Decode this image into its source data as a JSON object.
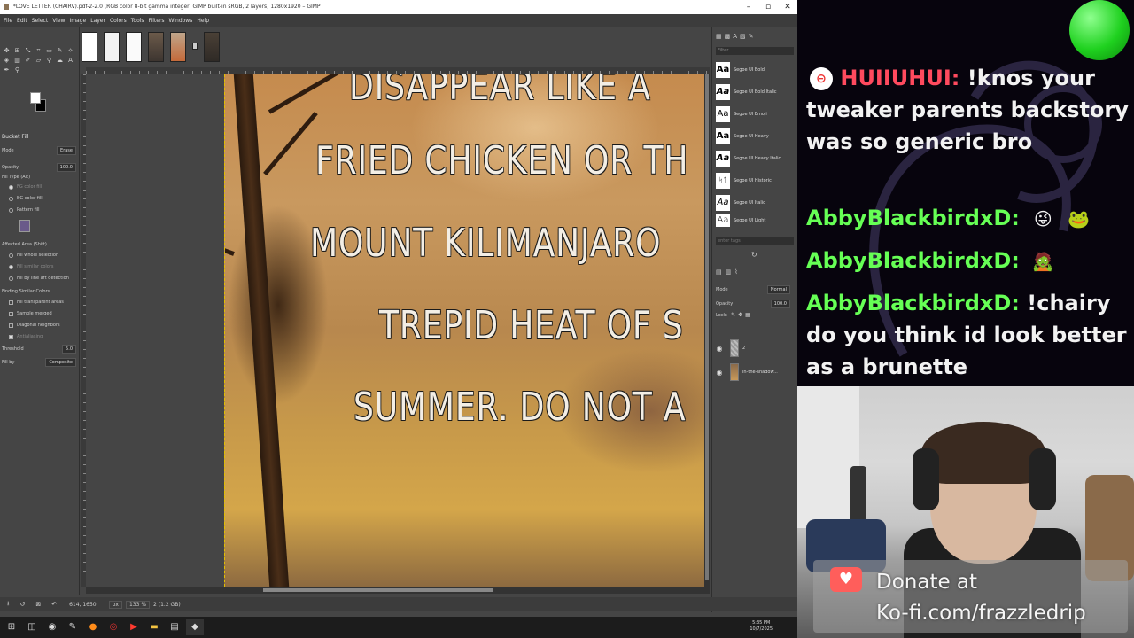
{
  "gimp": {
    "title": "*LOVE LETTER (CHAIRV).pdf-2-2.0 (RGB color 8-bit gamma integer, GIMP built-in sRGB, 2 layers) 1280x1920 – GIMP",
    "window_controls": [
      "–",
      "▫",
      "✕"
    ],
    "menu": [
      "File",
      "Edit",
      "Select",
      "View",
      "Image",
      "Layer",
      "Colors",
      "Tools",
      "Filters",
      "Windows",
      "Help"
    ],
    "tool_options": {
      "title": "Bucket Fill",
      "mode_label": "Mode",
      "mode_value": "Erase",
      "opacity_label": "Opacity",
      "opacity_value": "100.0",
      "fill_type_label": "Fill Type  (Alt)",
      "fill_types": [
        "FG color fill",
        "BG color fill",
        "Pattern fill"
      ],
      "affected_area_label": "Affected Area  (Shift)",
      "affected_areas": [
        "Fill whole selection",
        "Fill similar colors",
        "Fill by line art detection"
      ],
      "finding_label": "Finding Similar Colors",
      "finding_options": [
        "Fill transparent areas",
        "Sample merged",
        "Diagonal neighbors",
        "Antialiasing"
      ],
      "threshold_label": "Threshold",
      "threshold_value": "5.0",
      "fill_by_label": "Fill by",
      "fill_by_value": "Composite"
    },
    "canvas_text": [
      "DISAPPEAR LIKE A",
      "FRIED CHICKEN OR TH",
      "MOUNT KILIMANJARO",
      "TREPID HEAT OF S",
      "SUMMER. DO NOT A"
    ],
    "status": {
      "coords": "614, 1650",
      "unit": "px",
      "zoom": "133 %",
      "info": "2 (1.2 GB)"
    },
    "fonts": [
      "Segoe UI Bold",
      "Segoe UI Bold Italic",
      "Segoe UI Emoji",
      "Segoe UI Heavy",
      "Segoe UI Heavy Italic",
      "Segoe UI Historic",
      "Segoe UI Italic",
      "Segoe UI Light"
    ],
    "font_filter_placeholder": "Filter",
    "tags_placeholder": "enter tags",
    "layers": {
      "mode_label": "Mode",
      "mode_value": "Normal",
      "opacity_label": "Opacity",
      "opacity_value": "100.0",
      "lock_label": "Lock:",
      "items": [
        "2",
        "in-the-shadow..."
      ]
    },
    "clock": {
      "time": "5:35 PM",
      "date": "10/7/2025"
    }
  },
  "chat": {
    "messages": [
      {
        "user": "HUIIUHUI:",
        "text": "!knos your tweaker parents backstory was so generic bro",
        "color": "#ff4a5e"
      },
      {
        "user": "AbbyBlackbirdxD:",
        "text": "",
        "emotes": [
          "😜",
          "🐸"
        ],
        "color": "#66ff55"
      },
      {
        "user": "AbbyBlackbirdxD:",
        "text": "",
        "emotes": [
          "🧟"
        ],
        "color": "#66ff55"
      },
      {
        "user": "AbbyBlackbirdxD:",
        "text": "!chairy do you think id look better as a brunette",
        "color": "#66ff55"
      }
    ]
  },
  "donate": {
    "line1": "Donate at",
    "line2": "Ko-fi.com/frazzledrip"
  }
}
